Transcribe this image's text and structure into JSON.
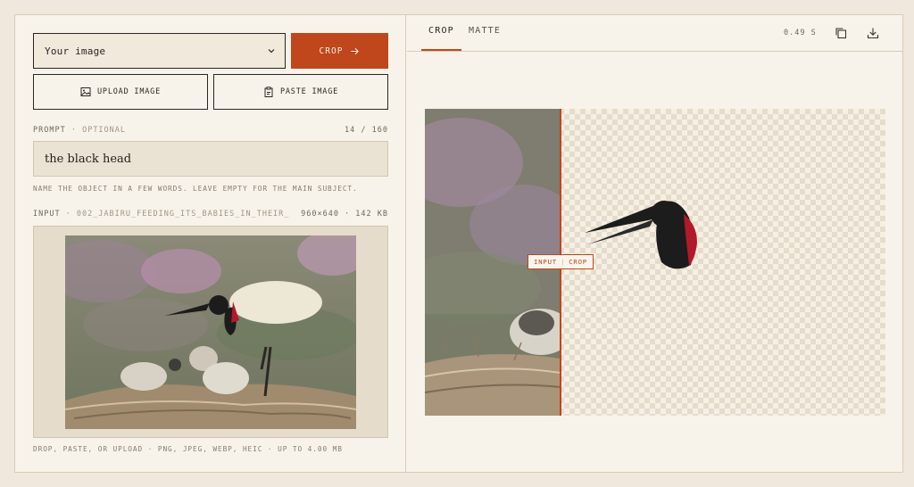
{
  "controls": {
    "image_select": "Your image",
    "crop_label": "CROP",
    "upload_label": "UPLOAD IMAGE",
    "paste_label": "PASTE IMAGE"
  },
  "prompt": {
    "label": "PROMPT",
    "optional": "· OPTIONAL",
    "count": "14 / 160",
    "value": "the black head",
    "hint": "NAME THE OBJECT IN A FEW WORDS. LEAVE EMPTY FOR THE MAIN SUBJECT."
  },
  "input": {
    "label": "INPUT",
    "filename": "· 002_JABIRU_FEEDING_ITS_BABIES_IN_THEIR_",
    "meta": "960×640 · 142 KB",
    "footer": "DROP, PASTE, OR UPLOAD · PNG, JPEG, WEBP, HEIC · UP TO 4.00 MB"
  },
  "result": {
    "tabs": [
      "CROP",
      "MATTE"
    ],
    "time": "0.49 S",
    "split_left": "INPUT",
    "split_right": "CROP"
  },
  "colors": {
    "accent": "#c0461b",
    "background": "#f0e8dc",
    "panel": "#f8f3ea"
  },
  "icons": [
    "chevron-down-icon",
    "arrow-right-icon",
    "image-icon",
    "clipboard-icon",
    "copy-icon",
    "download-icon"
  ]
}
